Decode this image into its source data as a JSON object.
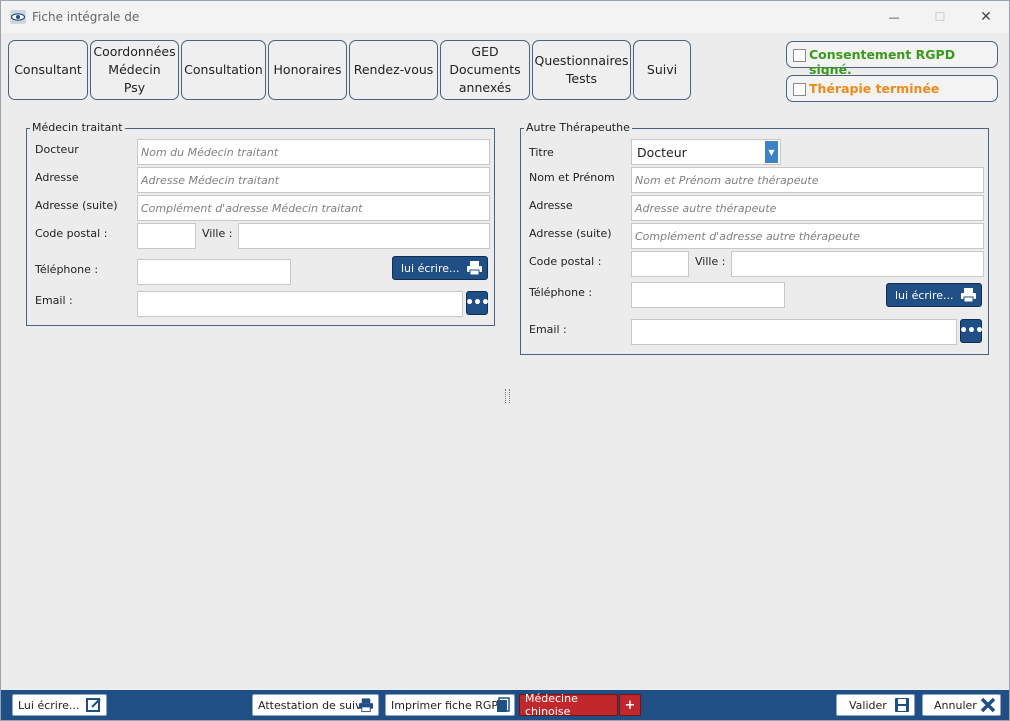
{
  "window": {
    "title": "Fiche intégrale de",
    "minimize": "—",
    "maximize": "☐",
    "close": "✕"
  },
  "tabs": [
    {
      "label": "Consultant"
    },
    {
      "label": "Coordonnées\nMédecin\nPsy"
    },
    {
      "label": "Consultation"
    },
    {
      "label": "Honoraires"
    },
    {
      "label": "Rendez-vous"
    },
    {
      "label": "GED\nDocuments\nannexés"
    },
    {
      "label": "Questionnaires\nTests"
    },
    {
      "label": "Suivi"
    }
  ],
  "checkboxes": {
    "rgpd": {
      "label": "Consentement RGPD signé.",
      "checked": false,
      "color": "#3a9a1a"
    },
    "therapie": {
      "label": "Thérapie terminée",
      "checked": false,
      "color": "#ef8a1a"
    }
  },
  "medecin": {
    "legend": "Médecin traitant",
    "docteur_label": "Docteur",
    "docteur_placeholder": "Nom du Médecin traitant",
    "adresse_label": "Adresse",
    "adresse_placeholder": "Adresse Médecin traitant",
    "adresse2_label": "Adresse (suite)",
    "adresse2_placeholder": "Complément d'adresse Médecin traitant",
    "cp_label": "Code postal :",
    "ville_label": "Ville :",
    "tel_label": "Téléphone :",
    "email_label": "Email :",
    "ecrire": "lui écrire...",
    "dots": "•••"
  },
  "autre": {
    "legend": "Autre Thérapeuthe",
    "titre_label": "Titre",
    "titre_value": "Docteur",
    "nom_label": "Nom et Prénom",
    "nom_placeholder": "Nom et Prénom autre thérapeute",
    "adresse_label": "Adresse",
    "adresse_placeholder": "Adresse autre thérapeute",
    "adresse2_label": "Adresse (suite)",
    "adresse2_placeholder": "Complément d'adresse autre thérapeute",
    "cp_label": "Code postal :",
    "ville_label": "Ville :",
    "tel_label": "Téléphone :",
    "email_label": "Email :",
    "ecrire": "lui écrire...",
    "dots": "•••"
  },
  "bottom": {
    "lui_ecrire": "Lui écrire...",
    "attestation": "Attestation de suivi",
    "imprimer": "Imprimer fiche RGPD",
    "medecine": "Médecine chinoise",
    "plus": "+",
    "valider": "Valider",
    "annuler": "Annuler"
  },
  "colors": {
    "accent": "#1f4f85",
    "medecine_bg": "#c0282b"
  }
}
